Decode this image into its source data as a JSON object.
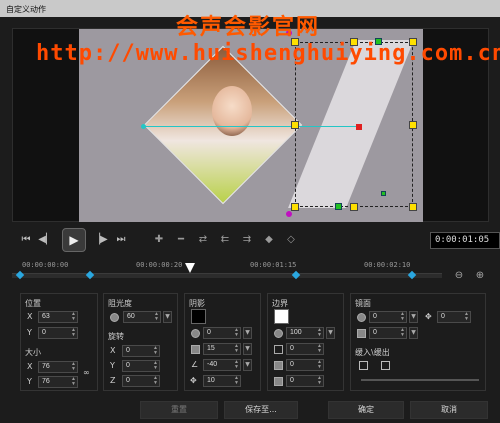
{
  "window": {
    "title": "自定义动作"
  },
  "watermark": {
    "line1": "会声会影官网",
    "line2": "http://www.huishenghuiying.com.cn"
  },
  "transport": {
    "timecode": "0:00:01:05",
    "icons": [
      "go-to-start-icon",
      "prev-frame-icon",
      "play-icon",
      "next-frame-icon",
      "go-to-end-icon"
    ],
    "keyframe_tools": [
      "add-keyframe-icon",
      "remove-keyframe-icon",
      "reverse-keyframes-icon",
      "move-keyframe-left-icon",
      "move-keyframe-right-icon",
      "prev-keyframe-icon",
      "next-keyframe-icon"
    ]
  },
  "timeline": {
    "labels": [
      "00:00:00:00",
      "00:00:00:20",
      "00:00:01:15",
      "00:00:02:10"
    ]
  },
  "position": {
    "title": "位置",
    "x": "63",
    "y": "0"
  },
  "size": {
    "title": "大小",
    "x": "76",
    "y": "76"
  },
  "opacity": {
    "title": "阻光度",
    "value": "60"
  },
  "rotation": {
    "title": "旋转",
    "x": "0",
    "y": "0",
    "z": "0"
  },
  "shadow": {
    "title": "阴影",
    "color": "#000000",
    "v1": "0",
    "v2": "15",
    "angle": "-40",
    "dist": "10"
  },
  "border": {
    "title": "边界",
    "color": "#ffffff",
    "v1": "100",
    "v2": "0",
    "v3": "0",
    "v4": "0"
  },
  "mirror": {
    "title": "镜面",
    "v1": "0",
    "v2": "0",
    "v3": "0"
  },
  "fade": {
    "title": "缓入\\缓出"
  },
  "footer": {
    "reset": "重置",
    "save_as": "保存至...",
    "ok": "确定",
    "cancel": "取消"
  },
  "colors": {
    "accent_keyframe": "#2aa7e0",
    "handle": "#ffe000",
    "watermark": "#ff4a00"
  }
}
